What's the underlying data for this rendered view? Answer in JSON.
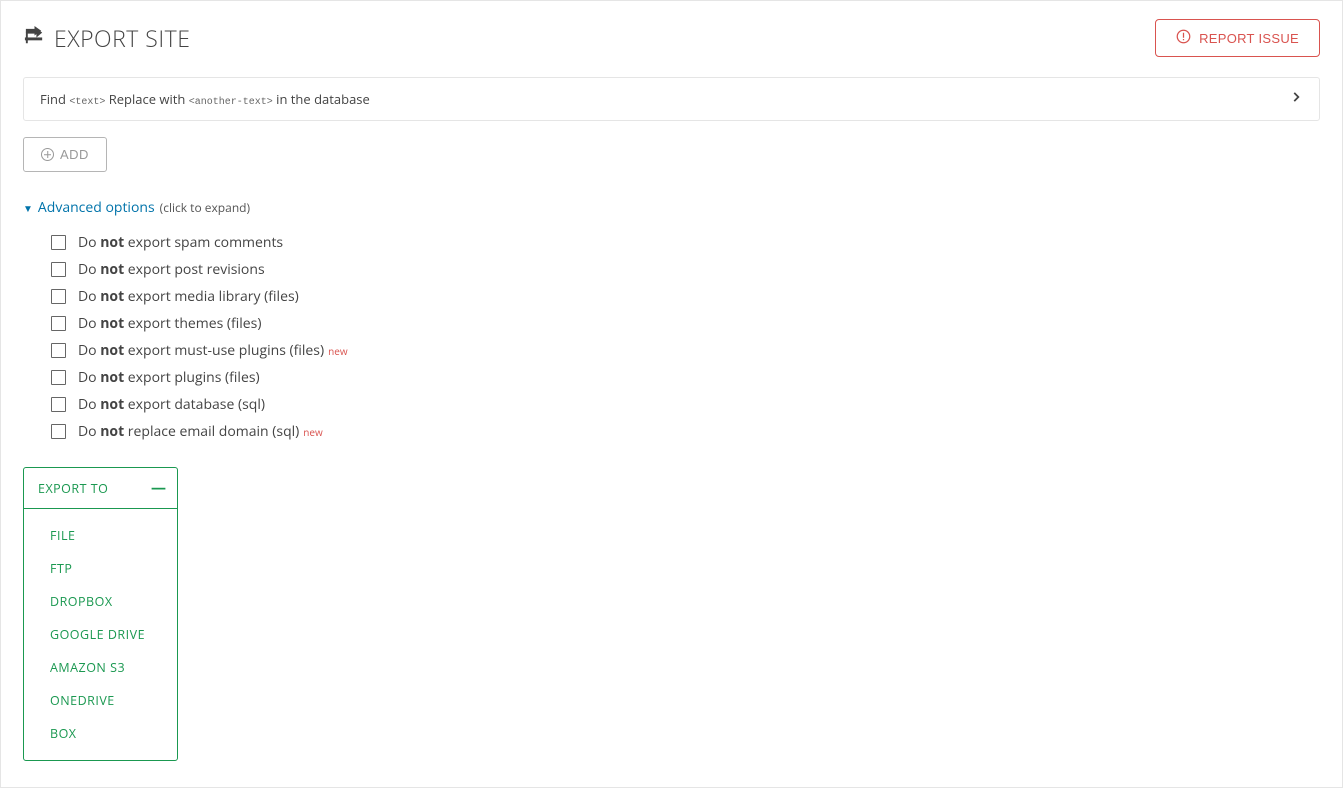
{
  "header": {
    "title": "EXPORT SITE",
    "report_btn": "REPORT ISSUE"
  },
  "find_replace": {
    "find_label": "Find",
    "text_tag": "<text>",
    "replace_label": "Replace with",
    "another_tag": "<another-text>",
    "in_db": "in the database"
  },
  "add_btn": "ADD",
  "advanced": {
    "label": "Advanced options",
    "hint": "(click to expand)",
    "options": [
      {
        "pre": "Do ",
        "strong": "not",
        "post": " export spam comments",
        "new": false
      },
      {
        "pre": "Do ",
        "strong": "not",
        "post": " export post revisions",
        "new": false
      },
      {
        "pre": "Do ",
        "strong": "not",
        "post": " export media library (files)",
        "new": false
      },
      {
        "pre": "Do ",
        "strong": "not",
        "post": " export themes (files)",
        "new": false
      },
      {
        "pre": "Do ",
        "strong": "not",
        "post": " export must-use plugins (files)",
        "new": true
      },
      {
        "pre": "Do ",
        "strong": "not",
        "post": " export plugins (files)",
        "new": false
      },
      {
        "pre": "Do ",
        "strong": "not",
        "post": " export database (sql)",
        "new": false
      },
      {
        "pre": "Do ",
        "strong": "not",
        "post": " replace email domain (sql)",
        "new": true
      }
    ],
    "new_badge": "new"
  },
  "export": {
    "header": "EXPORT TO",
    "items": [
      "FILE",
      "FTP",
      "DROPBOX",
      "GOOGLE DRIVE",
      "AMAZON S3",
      "ONEDRIVE",
      "BOX"
    ]
  }
}
